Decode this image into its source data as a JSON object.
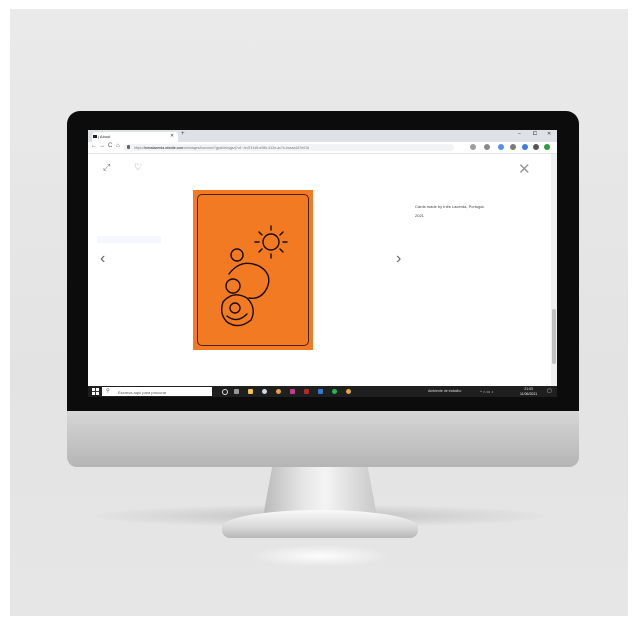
{
  "browser": {
    "tab_title": "| About",
    "tab_close": "✕",
    "new_tab": "+",
    "window_controls": {
      "minimize": "–",
      "maximize": "⧠",
      "close": "✕"
    },
    "nav": {
      "back": "←",
      "forward": "→",
      "reload": "C",
      "home": "⌂"
    },
    "url_prefix": "https://",
    "url_domain": "inesslacerda.wixsite.com",
    "url_path": "/onimages/fourown/?gpzk/elnqjzzj?u1~/ed741d9-e05h-412e-ac7k-bceaa167e016"
  },
  "page": {
    "expand_icon": "⤢",
    "heart_icon": "♡",
    "close_icon": "✕",
    "prev_arrow": "‹",
    "next_arrow": "›",
    "caption_line1": "Cards made by Inês Lacerda, Portugal.",
    "caption_line2": "2021",
    "card_color": "#f17a23"
  },
  "taskbar": {
    "search_placeholder": "Escreva aqui para procurar",
    "tray_text": "Ambiente de trabalho",
    "time": "21:03",
    "date": "11/06/2021"
  }
}
